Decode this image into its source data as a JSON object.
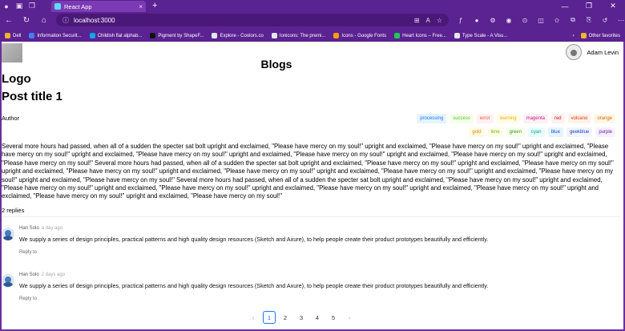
{
  "browser": {
    "tab_title": "React App",
    "tab_close": "×",
    "new_tab": "+",
    "address": "localhost:3000",
    "bookmarks": [
      {
        "label": "Dell",
        "color": "#f0b429"
      },
      {
        "label": "Information Securit...",
        "color": "#3b82f6"
      },
      {
        "label": "Childish flat alphab...",
        "color": "#0ea5e9"
      },
      {
        "label": "Pigment by ShapeF...",
        "color": "#111111"
      },
      {
        "label": "Explore - Coolors.co",
        "color": "#e5e7eb"
      },
      {
        "label": "Ionicons: The premi...",
        "color": "#e5e7eb"
      },
      {
        "label": "Icons - Google Fonts",
        "color": "#f59e0b"
      },
      {
        "label": "Heart Icons – Free...",
        "color": "#22c55e"
      },
      {
        "label": "Type Scale - A Visu...",
        "color": "#e5e7eb"
      }
    ],
    "other_favorites": "Other favorites"
  },
  "header": {
    "title": "Blogs",
    "user_name": "Adam Levin"
  },
  "post": {
    "logo": "Logo",
    "title": "Post title 1",
    "author": "Author",
    "body": "Several more hours had passed, when all of a sudden the specter sat bolt upright and exclaimed, \"Please have mercy on my soul!\" upright and exclaimed, \"Please have mercy on my soul!\" upright and exclaimed, \"Please have mercy on my soul!\" upright and exclaimed, \"Please have mercy on my soul!\" upright and exclaimed, \"Please have mercy on my soul!\" upright and exclaimed, \"Please have mercy on my soul!\" upright and exclaimed, \"Please have mercy on my soul!\" Several more hours had passed, when all of a sudden the specter sat bolt upright and exclaimed, \"Please have mercy on my soul!\" upright and exclaimed, \"Please have mercy on my soul!\" upright and exclaimed, \"Please have mercy on my soul!\" upright and exclaimed, \"Please have mercy on my soul!\" upright and exclaimed, \"Please have mercy on my soul!\" upright and exclaimed, \"Please have mercy on my soul!\" upright and exclaimed, \"Please have mercy on my soul!\" Several more hours had passed, when all of a sudden the specter sat bolt upright and exclaimed, \"Please have mercy on my soul!\" upright and exclaimed, \"Please have mercy on my soul!\" upright and exclaimed, \"Please have mercy on my soul!\" upright and exclaimed, \"Please have mercy on my soul!\" upright and exclaimed, \"Please have mercy on my soul!\" upright and exclaimed, \"Please have mercy on my soul!\" upright and exclaimed, \"Please have mercy on my soul!\"",
    "tags": [
      {
        "label": "processing",
        "color": "#1677ff",
        "bg": "#e6f4ff"
      },
      {
        "label": "success",
        "color": "#52c41a",
        "bg": "#f6ffed"
      },
      {
        "label": "error",
        "color": "#ff4d4f",
        "bg": "#fff2f0"
      },
      {
        "label": "warning",
        "color": "#faad14",
        "bg": "#fffbe6"
      },
      {
        "label": "magenta",
        "color": "#c41d7f",
        "bg": "#fff0f6"
      },
      {
        "label": "red",
        "color": "#cf1322",
        "bg": "#fff1f0"
      },
      {
        "label": "volcano",
        "color": "#d4380d",
        "bg": "#fff2e8"
      },
      {
        "label": "orange",
        "color": "#d46b08",
        "bg": "#fff7e6"
      },
      {
        "label": "gold",
        "color": "#d48806",
        "bg": "#fffbe6"
      },
      {
        "label": "lime",
        "color": "#7cb305",
        "bg": "#fcffe6"
      },
      {
        "label": "green",
        "color": "#389e0d",
        "bg": "#f6ffed"
      },
      {
        "label": "cyan",
        "color": "#08979c",
        "bg": "#e6fffb"
      },
      {
        "label": "blue",
        "color": "#0958d9",
        "bg": "#e6f4ff"
      },
      {
        "label": "geekblue",
        "color": "#1d39c4",
        "bg": "#f0f5ff"
      },
      {
        "label": "purple",
        "color": "#531dab",
        "bg": "#f9f0ff"
      }
    ]
  },
  "comments": {
    "count_label": "2 replies",
    "items": [
      {
        "author": "Han Solo",
        "date": "a day ago",
        "text": "We supply a series of design principles, practical patterns and high quality design resources (Sketch and Axure), to help people create their product prototypes beautifully and efficiently.",
        "reply": "Reply to"
      },
      {
        "author": "Han Solo",
        "date": "2 days ago",
        "text": "We supply a series of design principles, practical patterns and high quality design resources (Sketch and Axure), to help people create their product prototypes beautifully and efficiently.",
        "reply": "Reply to"
      }
    ]
  },
  "pagination": {
    "prev": "‹",
    "next": "›",
    "pages": [
      "1",
      "2",
      "3",
      "4",
      "5"
    ],
    "current": "1"
  }
}
